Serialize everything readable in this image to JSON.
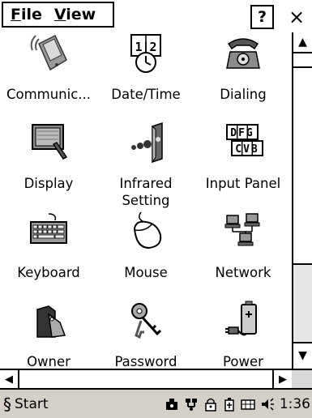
{
  "menu": {
    "file_prefix": "F",
    "file_rest": "ile",
    "view_prefix": "V",
    "view_rest": "iew",
    "help_label": "?",
    "close_label": "×"
  },
  "items": [
    {
      "label": "Communic...",
      "icon": "communications-icon"
    },
    {
      "label": "Date/Time",
      "icon": "date-time-icon"
    },
    {
      "label": "Dialing",
      "icon": "telephone-icon"
    },
    {
      "label": "Display",
      "icon": "display-icon"
    },
    {
      "label": "Infrared\nSetting",
      "icon": "infrared-icon"
    },
    {
      "label": "Input Panel",
      "icon": "input-panel-icon"
    },
    {
      "label": "Keyboard",
      "icon": "keyboard-icon"
    },
    {
      "label": "Mouse",
      "icon": "mouse-icon"
    },
    {
      "label": "Network",
      "icon": "network-icon"
    },
    {
      "label": "Owner",
      "icon": "owner-icon"
    },
    {
      "label": "Password",
      "icon": "keys-icon"
    },
    {
      "label": "Power",
      "icon": "power-plug-icon"
    }
  ],
  "icon_text": {
    "date_top": "1|2",
    "input_row1": "DFG",
    "input_row2": "CVB"
  },
  "scroll": {
    "up": "▲",
    "down": "▼",
    "left": "◀",
    "right": "▶"
  },
  "taskbar": {
    "start_symbol": "§",
    "start_label": "Start",
    "clock": "1:36"
  }
}
